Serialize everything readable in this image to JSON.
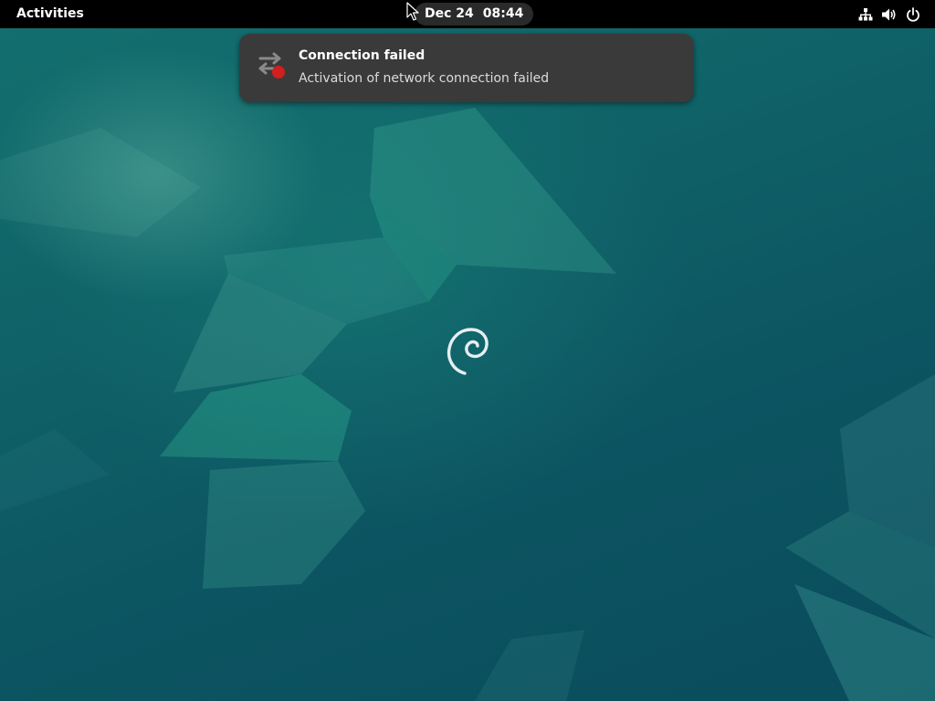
{
  "topbar": {
    "activities_label": "Activities",
    "clock": {
      "date": "Dec 24",
      "time": "08:44"
    },
    "systray": {
      "icons": [
        "network-wired-icon",
        "volume-icon",
        "power-icon"
      ]
    }
  },
  "notification": {
    "icon": "network-error-icon",
    "title": "Connection failed",
    "body": "Activation of network connection failed"
  },
  "desktop": {
    "logo": "debian-swirl-logo"
  },
  "colors": {
    "topbar": "#000000",
    "notification_bg": "#3a3a3a",
    "wallpaper": "#0d5561",
    "error_red": "#d01f1f"
  }
}
